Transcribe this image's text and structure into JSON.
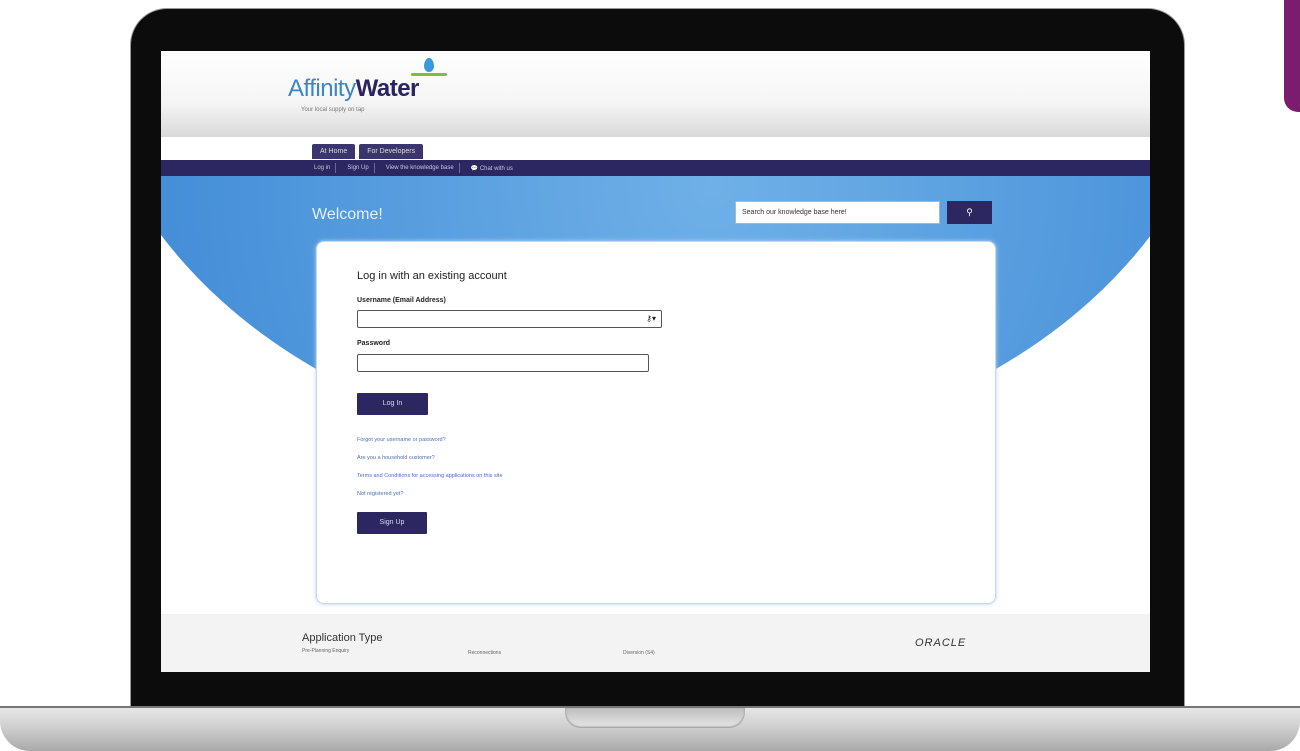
{
  "brand": {
    "name_part1": "Affinity",
    "name_part2": "Water",
    "tagline": "Your local supply on tap",
    "accent_color": "#2c2760",
    "purple_tab_color": "#7b1d6e"
  },
  "tabs": [
    {
      "label": "At Home"
    },
    {
      "label": "For Developers"
    }
  ],
  "nav": [
    {
      "label": "Log in"
    },
    {
      "label": "Sign Up"
    },
    {
      "label": "View the knowledge base"
    },
    {
      "label": "Chat with us",
      "icon": "chat-icon"
    }
  ],
  "banner": {
    "welcome": "Welcome!",
    "search_placeholder": "Search our knowledge base here!",
    "search_icon": "search-icon"
  },
  "login": {
    "heading": "Log in with an existing account",
    "username_label": "Username (Email Address)",
    "username_value": "",
    "password_label": "Password",
    "password_value": "",
    "login_button": "Log In",
    "links": [
      "Forgot your username or password?",
      "Are you a household customer?",
      "Terms and Conditions for accessing applications on this site",
      "Not registered yet?"
    ],
    "signup_button": "Sign Up"
  },
  "footer": {
    "title": "Application Type",
    "items": [
      "Pre-Planning Enquiry",
      "Reconnections",
      "Diversion (S4)"
    ],
    "vendor": "ORACLE"
  }
}
